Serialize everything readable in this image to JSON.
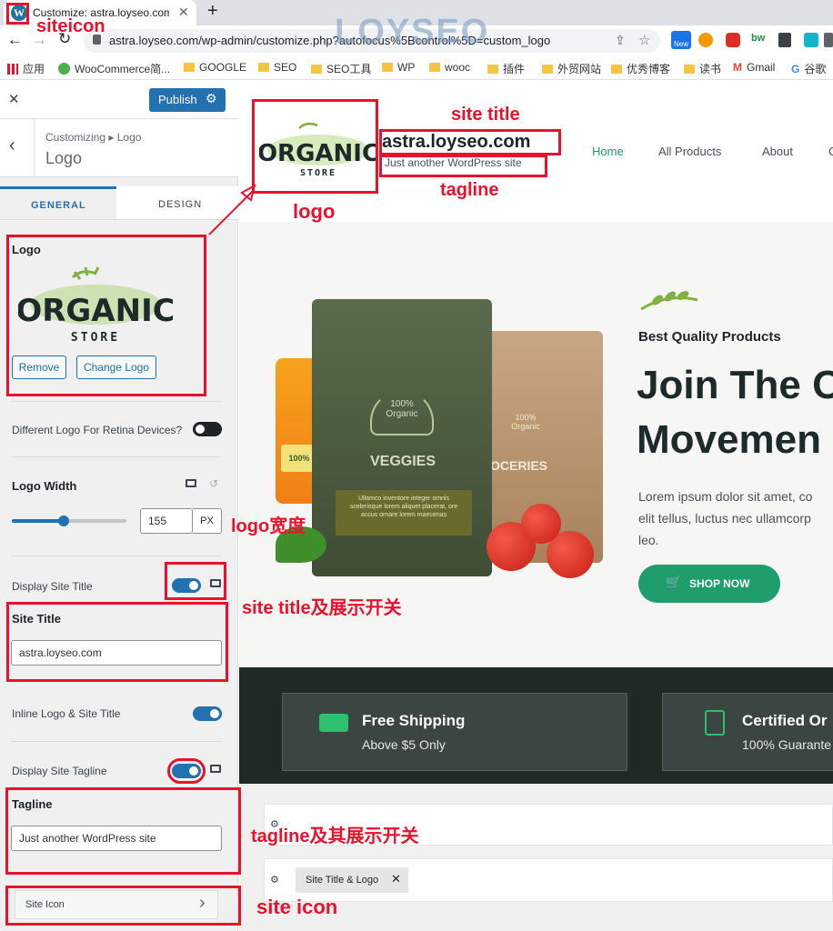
{
  "browser": {
    "tab_title": "Customize: astra.loyseo.com –",
    "new_tab": "+",
    "url": "astra.loyseo.com/wp-admin/customize.php?autofocus%5Bcontrol%5D=custom_logo",
    "watermark": "LOYSEO",
    "ext_new": "New",
    "ext_bw": "bw",
    "bookmarks": [
      "应用",
      "WooCommerce简...",
      "GOOGLE",
      "SEO",
      "SEO工具",
      "WP",
      "wooc",
      "插件",
      "外贸网站",
      "优秀博客",
      "读书",
      "Gmail",
      "谷歌"
    ]
  },
  "customizer": {
    "publish": "Publish",
    "breadcrumb": "Customizing ▸ Logo",
    "section_title": "Logo",
    "tabs": [
      "GENERAL",
      "DESIGN"
    ],
    "logo_label": "Logo",
    "logo_text_main": "ORGANIC",
    "logo_text_sub": "STORE",
    "remove": "Remove",
    "change_logo": "Change Logo",
    "retina_label": "Different Logo For Retina Devices?",
    "retina_on": false,
    "logo_width_label": "Logo Width",
    "logo_width_value": "155",
    "logo_width_unit": "PX",
    "logo_width_fraction": 0.45,
    "display_site_title_label": "Display Site Title",
    "display_site_title_on": true,
    "site_title_label": "Site Title",
    "site_title_value": "astra.loyseo.com",
    "inline_logo_label": "Inline Logo & Site Title",
    "inline_logo_on": true,
    "display_tagline_label": "Display Site Tagline",
    "display_tagline_on": true,
    "tagline_label": "Tagline",
    "tagline_value": "Just another WordPress site",
    "site_icon": "Site Icon"
  },
  "preview": {
    "site_title": "astra.loyseo.com",
    "tagline": "Just another WordPress site",
    "nav": [
      "Home",
      "All Products",
      "About",
      "C"
    ],
    "hero_kicker": "Best Quality Products",
    "hero_title_1": "Join The O",
    "hero_title_2": "Movemen",
    "hero_text_1": "Lorem ipsum dolor sit amet, co",
    "hero_text_2": "elit tellus, luctus nec ullamcorp",
    "hero_text_3": "leo.",
    "shop_now": "SHOP NOW",
    "bag1_badge": "100% Organic",
    "bag1_name": "VEGGIES",
    "bag1_small": "Ullamco inventore integer omnis scelerisque lorem aliquet placerat, ore accus ornare lorem maecenas",
    "bag2_badge": "100% Organic",
    "bag2_name": "OCERIES",
    "jar_label": "100%",
    "features": [
      {
        "title": "Free Shipping",
        "sub": "Above $5 Only"
      },
      {
        "title": "Certified Or",
        "sub": "100% Guarante"
      }
    ],
    "builder_chip": "Site Title & Logo"
  },
  "annotations": {
    "siteicon": "siteicon",
    "site_title": "site title",
    "tagline": "tagline",
    "logo": "logo",
    "logo_width": "logo宽度",
    "site_title_toggle": "site title及展示开关",
    "tagline_toggle": "tagline及其展示开关",
    "site_icon": "site icon"
  },
  "colors": {
    "accent": "#2271b1",
    "brand_green": "#1f9d6b",
    "annotation_red": "#e8132b",
    "dark_band": "#1e2a23"
  }
}
